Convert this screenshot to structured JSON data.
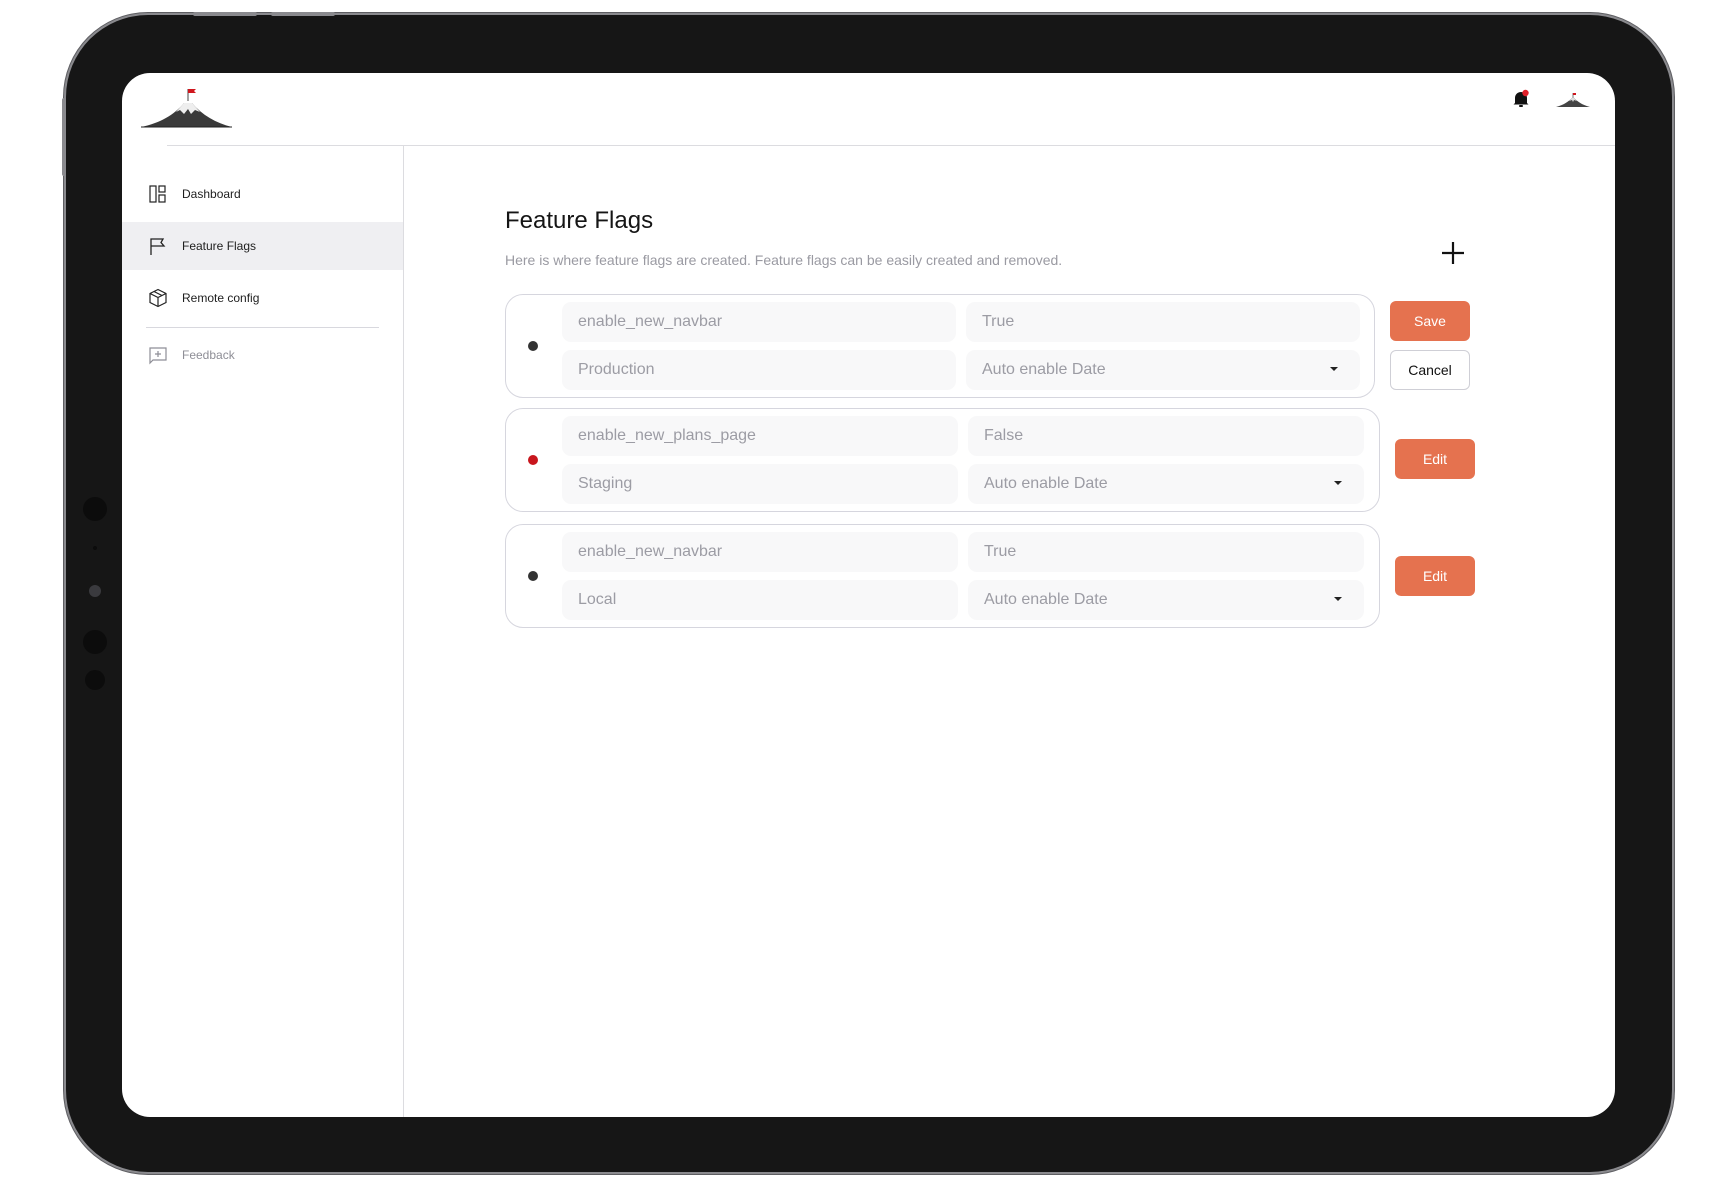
{
  "colors": {
    "accent": "#e5724f",
    "status_active": "#333333",
    "status_inactive": "#c8161d",
    "selected_nav_bg": "#efeff2"
  },
  "header": {
    "logo": "mountain-logo-icon",
    "notifications_icon": "bell-icon",
    "notifications_badge": true,
    "avatar": "mountain-avatar-icon"
  },
  "sidebar": {
    "items": [
      {
        "label": "Dashboard",
        "icon": "dashboard-icon",
        "active": false
      },
      {
        "label": "Feature Flags",
        "icon": "flag-icon",
        "active": true
      },
      {
        "label": "Remote config",
        "icon": "box-icon",
        "active": false
      }
    ],
    "footer_items": [
      {
        "label": "Feedback",
        "icon": "feedback-icon",
        "muted": true
      }
    ]
  },
  "main": {
    "title": "Feature Flags",
    "subtitle": "Here is where feature flags are created. Feature flags can be easily created and removed.",
    "add_icon": "plus-icon",
    "flags": [
      {
        "name": "enable_new_navbar",
        "value": "True",
        "environment": "Production",
        "date_placeholder": "Auto enable Date",
        "status": "active",
        "editing": true,
        "actions": [
          "Save",
          "Cancel"
        ]
      },
      {
        "name": "enable_new_plans_page",
        "value": "False",
        "environment": "Staging",
        "date_placeholder": "Auto enable Date",
        "status": "inactive",
        "editing": false,
        "actions": [
          "Edit"
        ]
      },
      {
        "name": "enable_new_navbar",
        "value": "True",
        "environment": "Local",
        "date_placeholder": "Auto enable Date",
        "status": "active",
        "editing": false,
        "actions": [
          "Edit"
        ]
      }
    ]
  }
}
